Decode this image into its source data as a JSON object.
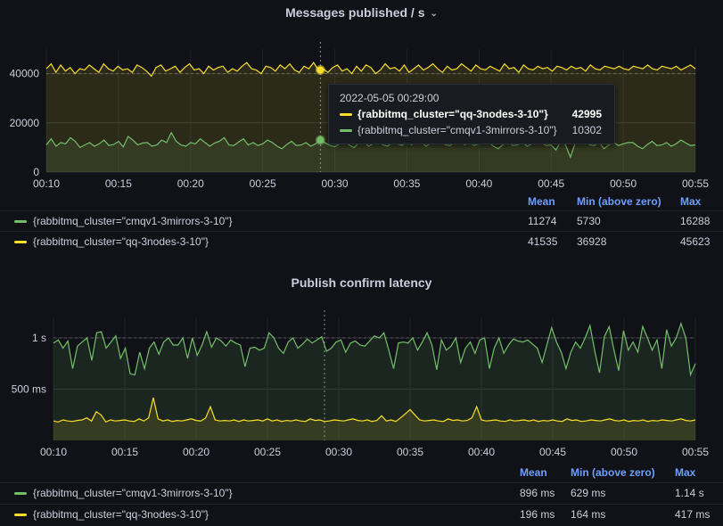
{
  "colors": {
    "green": "#73bf69",
    "yellow": "#fade2a",
    "bg": "#111217",
    "legend_header": "#6e9fff"
  },
  "panels": [
    {
      "title": "Messages published / s",
      "legend_headers": {
        "mean": "Mean",
        "min": "Min (above zero)",
        "max": "Max"
      },
      "legend_rows": [
        {
          "name": "{rabbitmq_cluster=\"cmqv1-3mirrors-3-10\"}",
          "mean": "11274",
          "min": "5730",
          "max": "16288",
          "color": "#73bf69"
        },
        {
          "name": "{rabbitmq_cluster=\"qq-3nodes-3-10\"}",
          "mean": "41535",
          "min": "36928",
          "max": "45623",
          "color": "#fade2a"
        }
      ],
      "tooltip": {
        "time": "2022-05-05 00:29:00",
        "rows": [
          {
            "name": "{rabbitmq_cluster=\"qq-3nodes-3-10\"}",
            "value": "42995",
            "color": "#fade2a"
          },
          {
            "name": "{rabbitmq_cluster=\"cmqv1-3mirrors-3-10\"}",
            "value": "10302",
            "color": "#73bf69"
          }
        ]
      }
    },
    {
      "title": "Publish confirm latency",
      "legend_headers": {
        "mean": "Mean",
        "min": "Min (above zero)",
        "max": "Max"
      },
      "legend_rows": [
        {
          "name": "{rabbitmq_cluster=\"cmqv1-3mirrors-3-10\"}",
          "mean": "896 ms",
          "min": "629 ms",
          "max": "1.14 s",
          "color": "#73bf69"
        },
        {
          "name": "{rabbitmq_cluster=\"qq-3nodes-3-10\"}",
          "mean": "196 ms",
          "min": "164 ms",
          "max": "417 ms",
          "color": "#fade2a"
        }
      ]
    }
  ],
  "chart_data": [
    {
      "type": "line",
      "title": "Messages published / s",
      "x_ticks": [
        "00:10",
        "00:15",
        "00:20",
        "00:25",
        "00:30",
        "00:35",
        "00:40",
        "00:45",
        "00:50",
        "00:55"
      ],
      "y_ticks": [
        "0",
        "20000",
        "40000"
      ],
      "y_tick_values": [
        0,
        20000,
        40000
      ],
      "x_range_minutes": [
        10,
        55
      ],
      "ylim": [
        0,
        50000
      ],
      "hover_minute": 29,
      "series": [
        {
          "name": "{rabbitmq_cluster=\"qq-3nodes-3-10\"}",
          "color": "#fade2a",
          "values": [
            42000,
            44000,
            40500,
            43500,
            41000,
            42500,
            40000,
            42000,
            41500,
            43500,
            42000,
            40500,
            44000,
            42000,
            41000,
            43000,
            41500,
            42000,
            40500,
            43500,
            42500,
            41000,
            39000,
            42500,
            43500,
            41000,
            42000,
            43000,
            40500,
            42500,
            44000,
            41500,
            42000,
            40000,
            43000,
            41500,
            42500,
            43000,
            40500,
            42000,
            41000,
            43000,
            44500,
            42000,
            41500,
            40000,
            43000,
            42500,
            41000,
            43500,
            42000,
            44000,
            41500,
            40500,
            43000,
            42000,
            44500,
            41500,
            42000,
            40500,
            42500,
            43500,
            41000,
            42000,
            40000,
            42995,
            41000,
            43500,
            42500,
            40000,
            41500,
            44000,
            42000,
            42500,
            41000,
            43500,
            40500,
            42000,
            43500,
            41500,
            42500,
            44000,
            42000,
            40500,
            43000,
            41500,
            42000,
            44000,
            42500,
            41000,
            43500,
            42000,
            41500,
            43000,
            42000,
            41000,
            44000,
            42000,
            42500,
            40500,
            43500,
            42000,
            41500,
            43000,
            42000,
            42500,
            41000,
            43000,
            42500,
            41500,
            43000,
            42000,
            42500,
            41000,
            43500,
            42000,
            41500,
            43000,
            42500,
            42000,
            43000,
            42000,
            41500,
            43000,
            42500,
            42000,
            43500,
            42000,
            41500,
            43000,
            42500,
            42000,
            43000,
            41500,
            42500,
            43500,
            42000
          ]
        },
        {
          "name": "{rabbitmq_cluster=\"cmqv1-3mirrors-3-10\"}",
          "color": "#73bf69",
          "values": [
            11000,
            13500,
            10500,
            12000,
            11500,
            14000,
            12500,
            10000,
            11000,
            12000,
            10500,
            11500,
            13000,
            10800,
            11200,
            12500,
            10200,
            14500,
            13000,
            11000,
            11800,
            12000,
            10500,
            11000,
            13000,
            12000,
            16000,
            12500,
            11000,
            10500,
            12000,
            11500,
            13500,
            12000,
            10500,
            11800,
            12500,
            14000,
            11000,
            10800,
            12200,
            13500,
            11000,
            12000,
            10800,
            11500,
            13000,
            12000,
            10500,
            9500,
            11200,
            12500,
            10800,
            11000,
            12000,
            10500,
            11500,
            13000,
            11800,
            10800,
            10302,
            11500,
            12500,
            11000,
            10000,
            11800,
            12500,
            10500,
            11500,
            13000,
            11000,
            10500,
            12000,
            11500,
            10800,
            12500,
            11000,
            13500,
            12000,
            10500,
            11800,
            12500,
            14000,
            11000,
            10800,
            12200,
            13500,
            11000,
            12000,
            10800,
            11500,
            13000,
            12000,
            10500,
            9500,
            11200,
            12500,
            10800,
            11000,
            12000,
            10500,
            11500,
            13000,
            11800,
            10800,
            11000,
            9000,
            12500,
            11000,
            6000,
            11800,
            12500,
            14000,
            11000,
            10800,
            12200,
            9500,
            11000,
            12000,
            10800,
            11500,
            12000,
            12000,
            10500,
            9500,
            11200,
            12500,
            10800,
            11000,
            12000,
            10500,
            11500,
            13000,
            11800,
            10800,
            11000
          ]
        }
      ]
    },
    {
      "type": "line",
      "title": "Publish confirm latency",
      "x_ticks": [
        "00:10",
        "00:15",
        "00:20",
        "00:25",
        "00:30",
        "00:35",
        "00:40",
        "00:45",
        "00:50",
        "00:55"
      ],
      "y_ticks": [
        "500 ms",
        "1 s"
      ],
      "y_tick_values": [
        500,
        1000
      ],
      "x_range_minutes": [
        10,
        55
      ],
      "ylim": [
        0,
        1200
      ],
      "y_unit": "ms",
      "hover_minute": 29,
      "series": [
        {
          "name": "{rabbitmq_cluster=\"cmqv1-3mirrors-3-10\"}",
          "color": "#73bf69",
          "values": [
            950,
            980,
            900,
            970,
            700,
            920,
            960,
            1000,
            780,
            1050,
            1060,
            900,
            960,
            1020,
            800,
            900,
            650,
            640,
            860,
            700,
            900,
            960,
            840,
            960,
            1000,
            930,
            930,
            1000,
            800,
            1000,
            830,
            930,
            1060,
            910,
            1000,
            970,
            920,
            980,
            950,
            930,
            720,
            900,
            910,
            880,
            900,
            1050,
            1000,
            900,
            850,
            960,
            1000,
            900,
            940,
            990,
            950,
            980,
            1010,
            870,
            900,
            960,
            980,
            860,
            950,
            970,
            930,
            920,
            970,
            1020,
            1000,
            1050,
            880,
            700,
            950,
            960,
            950,
            1000,
            880,
            960,
            1050,
            930,
            690,
            980,
            880,
            920,
            1000,
            760,
            900,
            960,
            850,
            980,
            1000,
            700,
            900,
            1000,
            850,
            930,
            990,
            970,
            960,
            980,
            940,
            900,
            760,
            930,
            1100,
            960,
            860,
            700,
            860,
            960,
            900,
            1000,
            1120,
            870,
            660,
            1010,
            1110,
            880,
            680,
            1070,
            880,
            960,
            860,
            1110,
            1000,
            880,
            980,
            700,
            1080,
            920,
            1000,
            1140,
            1000,
            640,
            750
          ]
        },
        {
          "name": "{rabbitmq_cluster=\"qq-3nodes-3-10\"}",
          "color": "#fade2a",
          "values": [
            190,
            180,
            200,
            190,
            185,
            195,
            200,
            220,
            190,
            280,
            250,
            180,
            200,
            190,
            195,
            200,
            190,
            185,
            210,
            190,
            220,
            417,
            210,
            190,
            200,
            185,
            195,
            190,
            200,
            210,
            195,
            190,
            220,
            330,
            200,
            190,
            195,
            190,
            200,
            185,
            200,
            190,
            195,
            200,
            190,
            210,
            190,
            200,
            185,
            195,
            190,
            200,
            190,
            185,
            210,
            195,
            200,
            185,
            190,
            200,
            195,
            190,
            200,
            210,
            195,
            190,
            200,
            185,
            195,
            240,
            190,
            200,
            185,
            220,
            260,
            300,
            250,
            200,
            190,
            195,
            200,
            190,
            185,
            210,
            195,
            200,
            190,
            195,
            220,
            330,
            200,
            190,
            195,
            200,
            190,
            185,
            200,
            190,
            195,
            200,
            190,
            200,
            185,
            195,
            190,
            200,
            190,
            185,
            210,
            195,
            200,
            185,
            190,
            200,
            195,
            190,
            200,
            210,
            195,
            190,
            200,
            185,
            195,
            190,
            200,
            185,
            195,
            190,
            200,
            195,
            190,
            200,
            210,
            195,
            190,
            200
          ]
        }
      ]
    }
  ]
}
